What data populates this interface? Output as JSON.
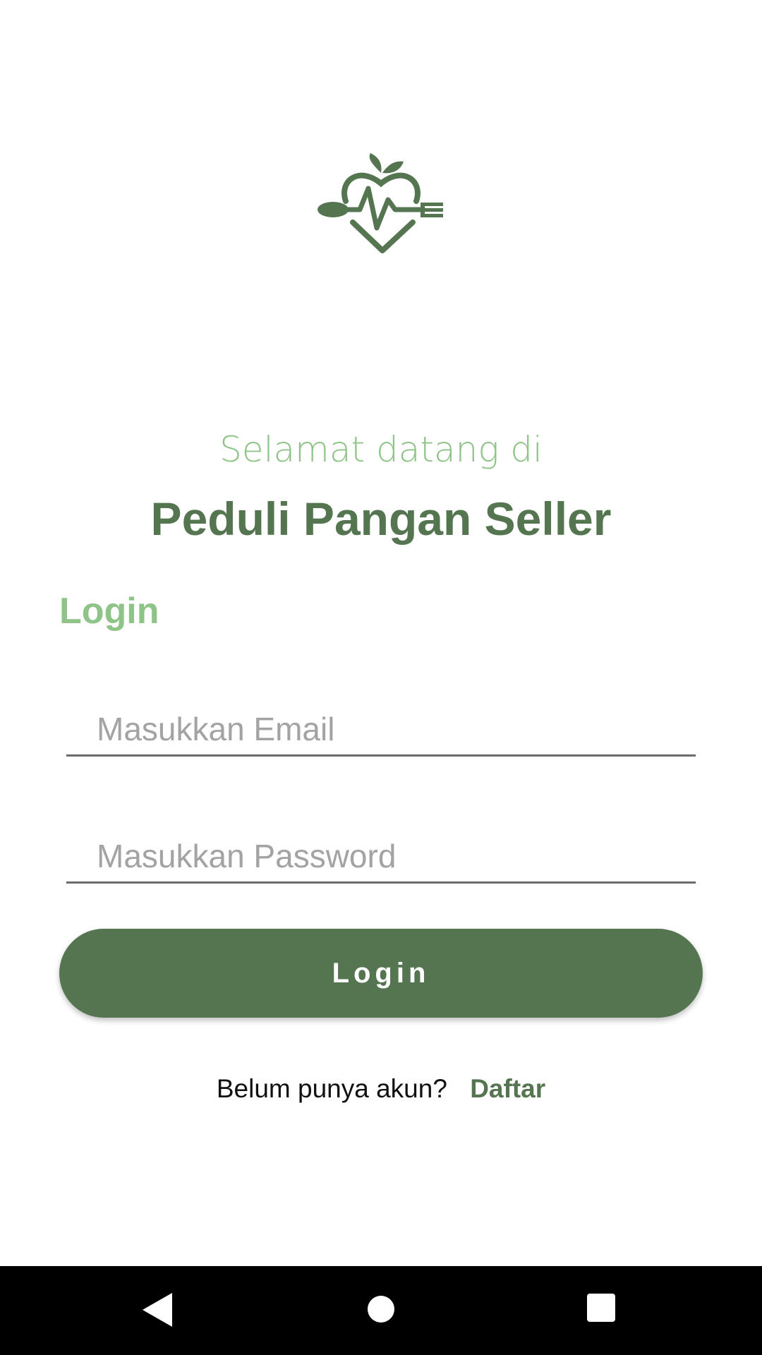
{
  "app": {
    "logo_icon": "heart-cutlery-icon",
    "welcome_text": "Selamat datang di",
    "title": "Peduli Pangan Seller"
  },
  "login": {
    "section_title": "Login",
    "email_placeholder": "Masukkan Email",
    "password_placeholder": "Masukkan Password",
    "button_label": "Login"
  },
  "signup": {
    "prompt": "Belum punya akun?",
    "link_label": "Daftar"
  },
  "colors": {
    "primary": "#557551",
    "accent_light": "#8fc488",
    "navbar": "#000000"
  },
  "navigation_bar": {
    "back_icon": "back-triangle-icon",
    "home_icon": "home-circle-icon",
    "recents_icon": "recents-square-icon"
  }
}
